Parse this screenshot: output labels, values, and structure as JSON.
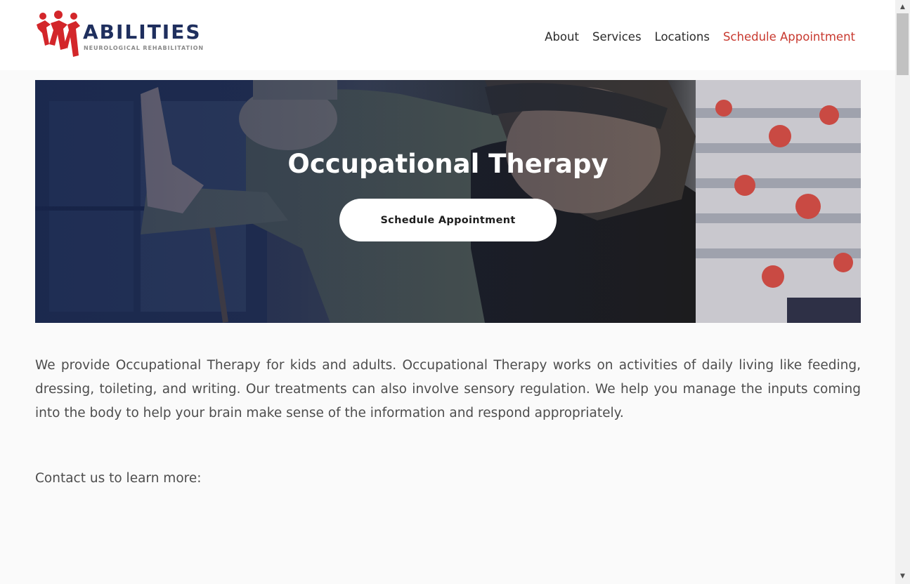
{
  "header": {
    "logo": {
      "name": "ABILITIES",
      "tagline": "NEUROLOGICAL REHABILITATION",
      "icon": "figures-logo-icon",
      "brand_red": "#d3262a",
      "brand_navy": "#1f2f5e"
    },
    "nav": [
      {
        "label": "About"
      },
      {
        "label": "Services"
      },
      {
        "label": "Locations"
      },
      {
        "label": "Schedule Appointment"
      }
    ],
    "accent_color": "#c8392f"
  },
  "hero": {
    "title": "Occupational Therapy",
    "button_label": "Schedule Appointment",
    "image": "therapy-session-photo"
  },
  "content": {
    "intro": "We provide Occupational Therapy for kids and adults. Occupational Therapy works on activities of daily living like feeding, dressing, toileting, and writing. Our treatments can also involve sensory regulation. We help you manage the inputs coming into the body to help your brain make sense of the information and respond appropriately.",
    "contact": "Contact us to learn more:"
  },
  "scrollbar": {
    "up_icon": "arrow-up-icon",
    "down_icon": "arrow-down-icon"
  }
}
